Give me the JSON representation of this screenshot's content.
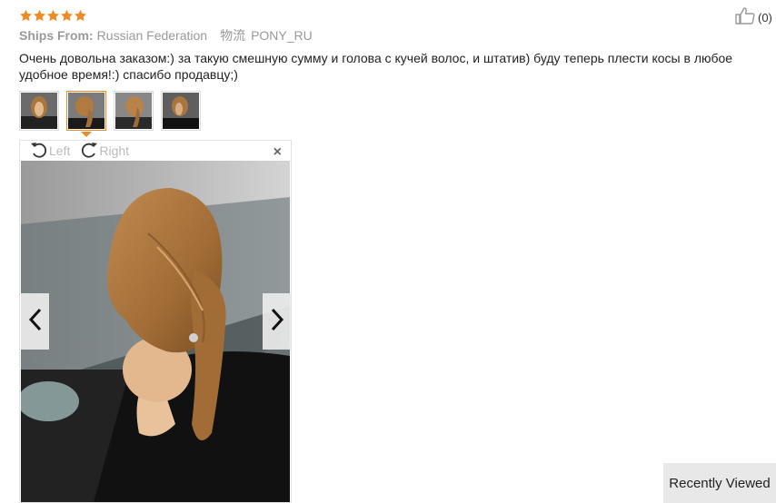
{
  "rating": {
    "stars": 5,
    "max": 5,
    "color": "#f08a24"
  },
  "shipping": {
    "label": "Ships From:",
    "country": "Russian Federation",
    "logistics_label": "物流",
    "carrier": "PONY_RU"
  },
  "helpful": {
    "count": "(0)",
    "icon": "thumbs-up-icon"
  },
  "review": {
    "text": "Очень довольна заказом:) за такую смешную сумму и голова с кучей волос, и штатив) буду теперь плести косы в любое удобное время!:) спасибо продавцу;)"
  },
  "thumbnails": {
    "count": 4,
    "active_index": 1,
    "active_color": "#f08a24"
  },
  "viewer": {
    "rotate_left_label": "Left",
    "rotate_right_label": "Right",
    "close_symbol": "×"
  },
  "recently_viewed": {
    "label": "Recently Viewed"
  }
}
